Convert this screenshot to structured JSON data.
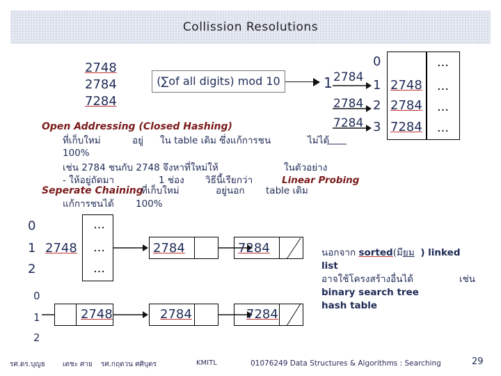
{
  "title": "Collission  Resolutions",
  "keys": [
    "2748",
    "2784",
    "7284"
  ],
  "hash_function": "(∑of all digits) mod 10",
  "collision_hash": "1",
  "top_table": {
    "indices": [
      "0",
      "1",
      "2",
      "3"
    ],
    "arrow_labels": [
      "2784",
      "2784",
      "7284"
    ],
    "values": [
      "",
      "2748",
      "2784",
      "7284"
    ],
    "more": [
      "…",
      "…",
      "…",
      "…"
    ]
  },
  "open_addressing": {
    "heading": "Open Addressing (Closed Hashing)",
    "line1a": "ที่เก็บใหม่",
    "line1b": "อยู่",
    "line1c": "ใน table เดิม  ซึ่งแก้การชน",
    "line1d": "ไม่ได้",
    "line2": "100%",
    "line3a": "เช่น  2784 ชนกับ  2748 จึงหาที่ใหม่ให้",
    "line3b": "ในตัวอย่าง",
    "line4a": "- ให้อยู่ถัดมา",
    "line4b": "1 ช่อง",
    "line4c": "วิธีนี้เรียกว่า",
    "line4d": "Linear Probing"
  },
  "separate_chaining": {
    "heading": "Seperate Chaining",
    "line1a": "ที่เก็บใหม่",
    "line1b": "อยู่นอก",
    "line1c": "table เดิม",
    "line2": "แก้การชนได้",
    "line2b": "100%"
  },
  "chain_table1": {
    "indices": [
      "0",
      "1",
      "2"
    ],
    "slot1": "2748",
    "dots": [
      "…",
      "…",
      "…"
    ],
    "node1": "2784",
    "node2": "7284"
  },
  "chain_table2": {
    "indices": [
      "0",
      "1",
      "2"
    ],
    "node0": "2748",
    "node1": "2784",
    "node2": "7284"
  },
  "note": {
    "line1a": "นอกจาก",
    "line1b": "sorted",
    "line1c": "(มี",
    "line1d": "ยม",
    "line1e": ") linked",
    "line2": "list",
    "line3a": "อาจใช้โครงสร้างอื่นได้",
    "line3b": "เช่น",
    "line4": "binary search tree",
    "line5": "hash table"
  },
  "footer": {
    "authors_a": "รศ.ดร.บุญธ",
    "authors_b": "เตชะ",
    "authors_c": "ศาย",
    "authors_d": "รศ.กฤตวน  ศศิบุตร",
    "org": "KMITL",
    "course": "01076249 Data Structures & Algorithms : Searching",
    "page": "29"
  },
  "colors": {
    "text": "#1e2a55",
    "underline": "#c03030",
    "heading": "#7a1a1a",
    "titlebar": "#e6eaf2"
  }
}
